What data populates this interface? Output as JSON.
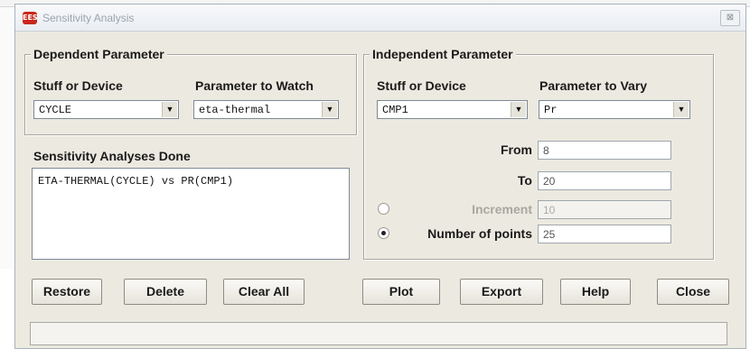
{
  "window": {
    "title": "Sensitivity Analysis",
    "app_icon_label": "EES",
    "close_symbol": "⊠"
  },
  "dependent": {
    "group_title": "Dependent Parameter",
    "stuff_label": "Stuff or Device",
    "stuff_value": "CYCLE",
    "watch_label": "Parameter to Watch",
    "watch_value": "eta-thermal"
  },
  "analyses": {
    "label": "Sensitivity Analyses Done",
    "items": [
      "ETA-THERMAL(CYCLE) vs PR(CMP1)"
    ]
  },
  "independent": {
    "group_title": "Independent Parameter",
    "stuff_label": "Stuff or Device",
    "stuff_value": "CMP1",
    "vary_label": "Parameter to Vary",
    "vary_value": "Pr",
    "from_label": "From",
    "from_value": "8",
    "to_label": "To",
    "to_value": "20",
    "increment_label": "Increment",
    "increment_value": "10",
    "increment_selected": false,
    "points_label": "Number of points",
    "points_value": "25",
    "points_selected": true
  },
  "buttons": {
    "restore": "Restore",
    "delete": "Delete",
    "clear_all": "Clear All",
    "plot": "Plot",
    "export": "Export",
    "help": "Help",
    "close": "Close"
  },
  "icons": {
    "dropdown": "▼"
  },
  "colors": {
    "dialog_bg": "#ece9e0",
    "app_icon": "#c8281c",
    "disabled_text": "#a9a79f"
  }
}
